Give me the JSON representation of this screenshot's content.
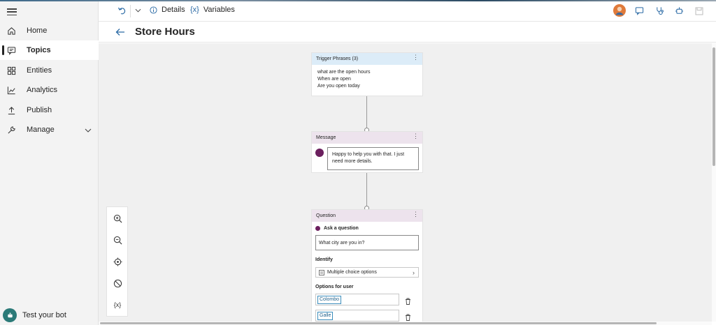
{
  "sidebar": {
    "items": [
      {
        "label": "Home",
        "icon": "home-icon"
      },
      {
        "label": "Topics",
        "icon": "chat-icon"
      },
      {
        "label": "Entities",
        "icon": "grid-icon"
      },
      {
        "label": "Analytics",
        "icon": "chart-icon"
      },
      {
        "label": "Publish",
        "icon": "upload-icon"
      },
      {
        "label": "Manage",
        "icon": "wrench-icon"
      }
    ],
    "active": "Topics",
    "test_bot_label": "Test your bot"
  },
  "header": {
    "details_label": "Details",
    "variables_label": "Variables",
    "variables_icon_text": "{x}"
  },
  "page": {
    "title": "Store Hours"
  },
  "canvas": {
    "toolbar": {
      "variables_icon_text": "{x}"
    },
    "trigger_node": {
      "title": "Trigger Phrases (3)",
      "phrases": [
        "what are the open hours",
        "When are open",
        "Are you open today"
      ]
    },
    "message_node": {
      "title": "Message",
      "text": "Happy to help you with that. I just need more details."
    },
    "question_node": {
      "title": "Question",
      "ask_label": "Ask a question",
      "question_text": "What city are you in?",
      "identify_label": "Identify",
      "identify_value": "Multiple choice options",
      "options_label": "Options for user",
      "options": [
        "Colombo",
        "Galle"
      ]
    }
  },
  "colors": {
    "accent": "#1f5f8a",
    "trigger_header": "#dcecf8",
    "node_header": "#ede3ed",
    "bot_icon": "#2b7a78",
    "message_icon": "#6b1f5e"
  }
}
